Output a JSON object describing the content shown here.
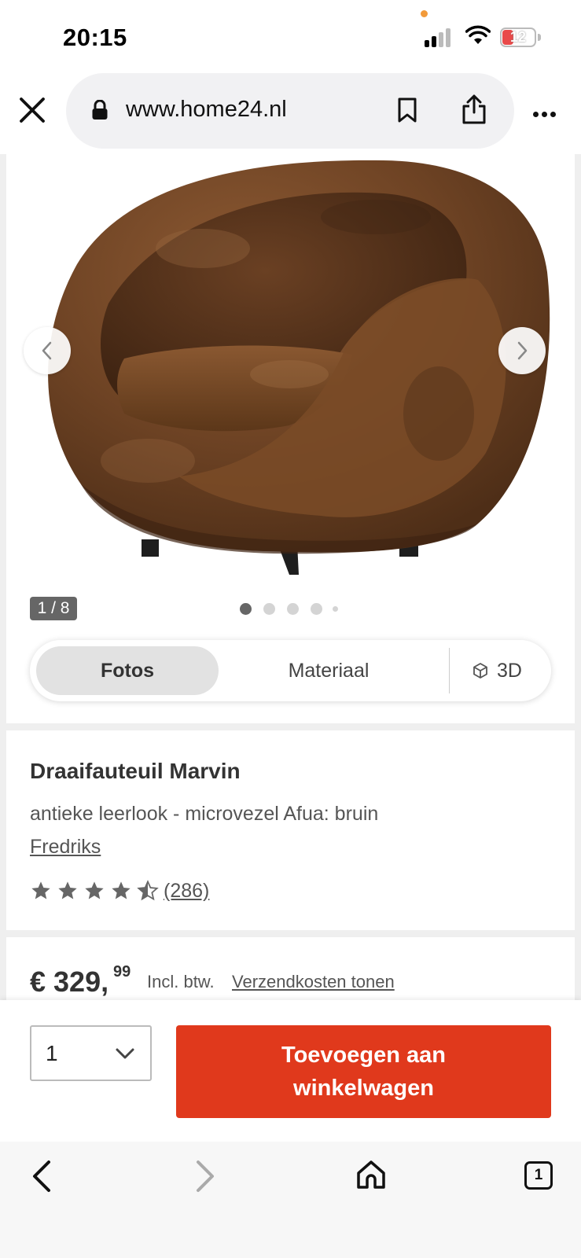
{
  "status_bar": {
    "time": "20:15",
    "battery_level": "12",
    "icons": [
      "signal-icon",
      "wifi-icon",
      "battery-icon"
    ]
  },
  "browser": {
    "url": "www.home24.nl",
    "icons": [
      "close-icon",
      "lock-icon",
      "bookmark-icon",
      "share-icon",
      "more-icon"
    ]
  },
  "gallery": {
    "counter": "1 / 8",
    "dots_total": 5,
    "active_dot": 0,
    "tabs": [
      {
        "label": "Fotos",
        "active": true
      },
      {
        "label": "Materiaal",
        "active": false
      },
      {
        "label": "3D",
        "active": false
      }
    ]
  },
  "product": {
    "title": "Draaifauteuil Marvin",
    "subtitle": "antieke leerlook - microvezel Afua: bruin",
    "brand": "Fredriks",
    "rating": 4.5,
    "rating_max": 5,
    "review_count": "(286)"
  },
  "price": {
    "main": "€ 329,",
    "cents": "99",
    "vat_note": "Incl. btw.",
    "shipping_link": "Verzendkosten tonen"
  },
  "cart": {
    "quantity": "1",
    "add_button": "Toevoegen aan winkelwagen"
  },
  "toolbar": {
    "tab_count": "1",
    "icons": [
      "back-icon",
      "forward-icon",
      "home-icon",
      "tabs-icon"
    ]
  },
  "colors": {
    "accent": "#e0391c",
    "chair_brown": "#7a4a26",
    "star": "#666666"
  }
}
